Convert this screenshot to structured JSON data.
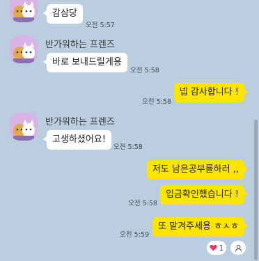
{
  "messages": [
    {
      "sender": "반가워하는 프렌즈",
      "text": "감삼당",
      "time": "오전 5:57",
      "direction": "in"
    },
    {
      "sender": "반가워하는 프렌즈",
      "text": "바로 보내드릴게용",
      "time": "오전 5:58",
      "direction": "in"
    },
    {
      "text": "넵 감사합니다 !",
      "time": "오전 5:58",
      "direction": "out"
    },
    {
      "sender": "반가워하는 프렌즈",
      "text": "고생하셨어요!",
      "time": "오전 5:58",
      "direction": "in"
    },
    {
      "text": "저도 남은공부를하러 ,,",
      "direction": "out"
    },
    {
      "text": "입금확인했습니다 !",
      "time": "오전 5:58",
      "direction": "out"
    },
    {
      "text": "또 맡겨주세용 ㅎㅅㅎ",
      "time": "오전 5:59",
      "direction": "out"
    }
  ],
  "reaction": {
    "icon": "heart-icon",
    "count": "1",
    "color": "#e8386b"
  },
  "colors": {
    "background": "#bacee0",
    "outgoing": "#fee500",
    "incoming": "#ffffff"
  }
}
